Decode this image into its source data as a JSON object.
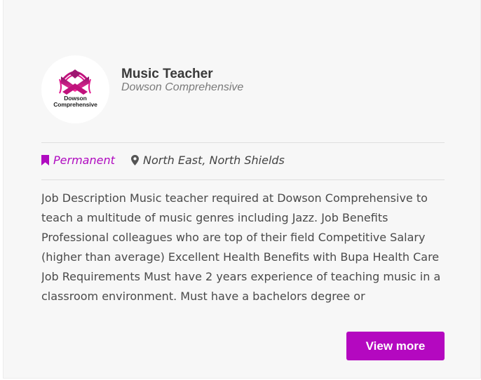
{
  "job": {
    "title": "Music Teacher",
    "company": "Dowson Comprehensive",
    "logo": {
      "icon": "dowson-comprehensive-logo",
      "line1": "Dowson",
      "line2": "Comprehensive",
      "color": "#e0168c"
    },
    "type": {
      "label": "Permanent",
      "icon": "bookmark-icon",
      "color": "#b00bc0"
    },
    "location": {
      "label": "North East, North Shields",
      "icon": "map-pin-icon"
    },
    "description": "Job Description Music teacher required at Dowson Comprehensive to teach a multitude of music genres including Jazz. Job Benefits Professional colleagues who are top of their field Competitive Salary (higher than average) Excellent Health Benefits with Bupa Health Care Job Requirements Must have 2 years experience of teaching music in a classroom environment. Must have a bachelors degree or",
    "cta": {
      "label": "View more",
      "color": "#b408c0"
    }
  }
}
